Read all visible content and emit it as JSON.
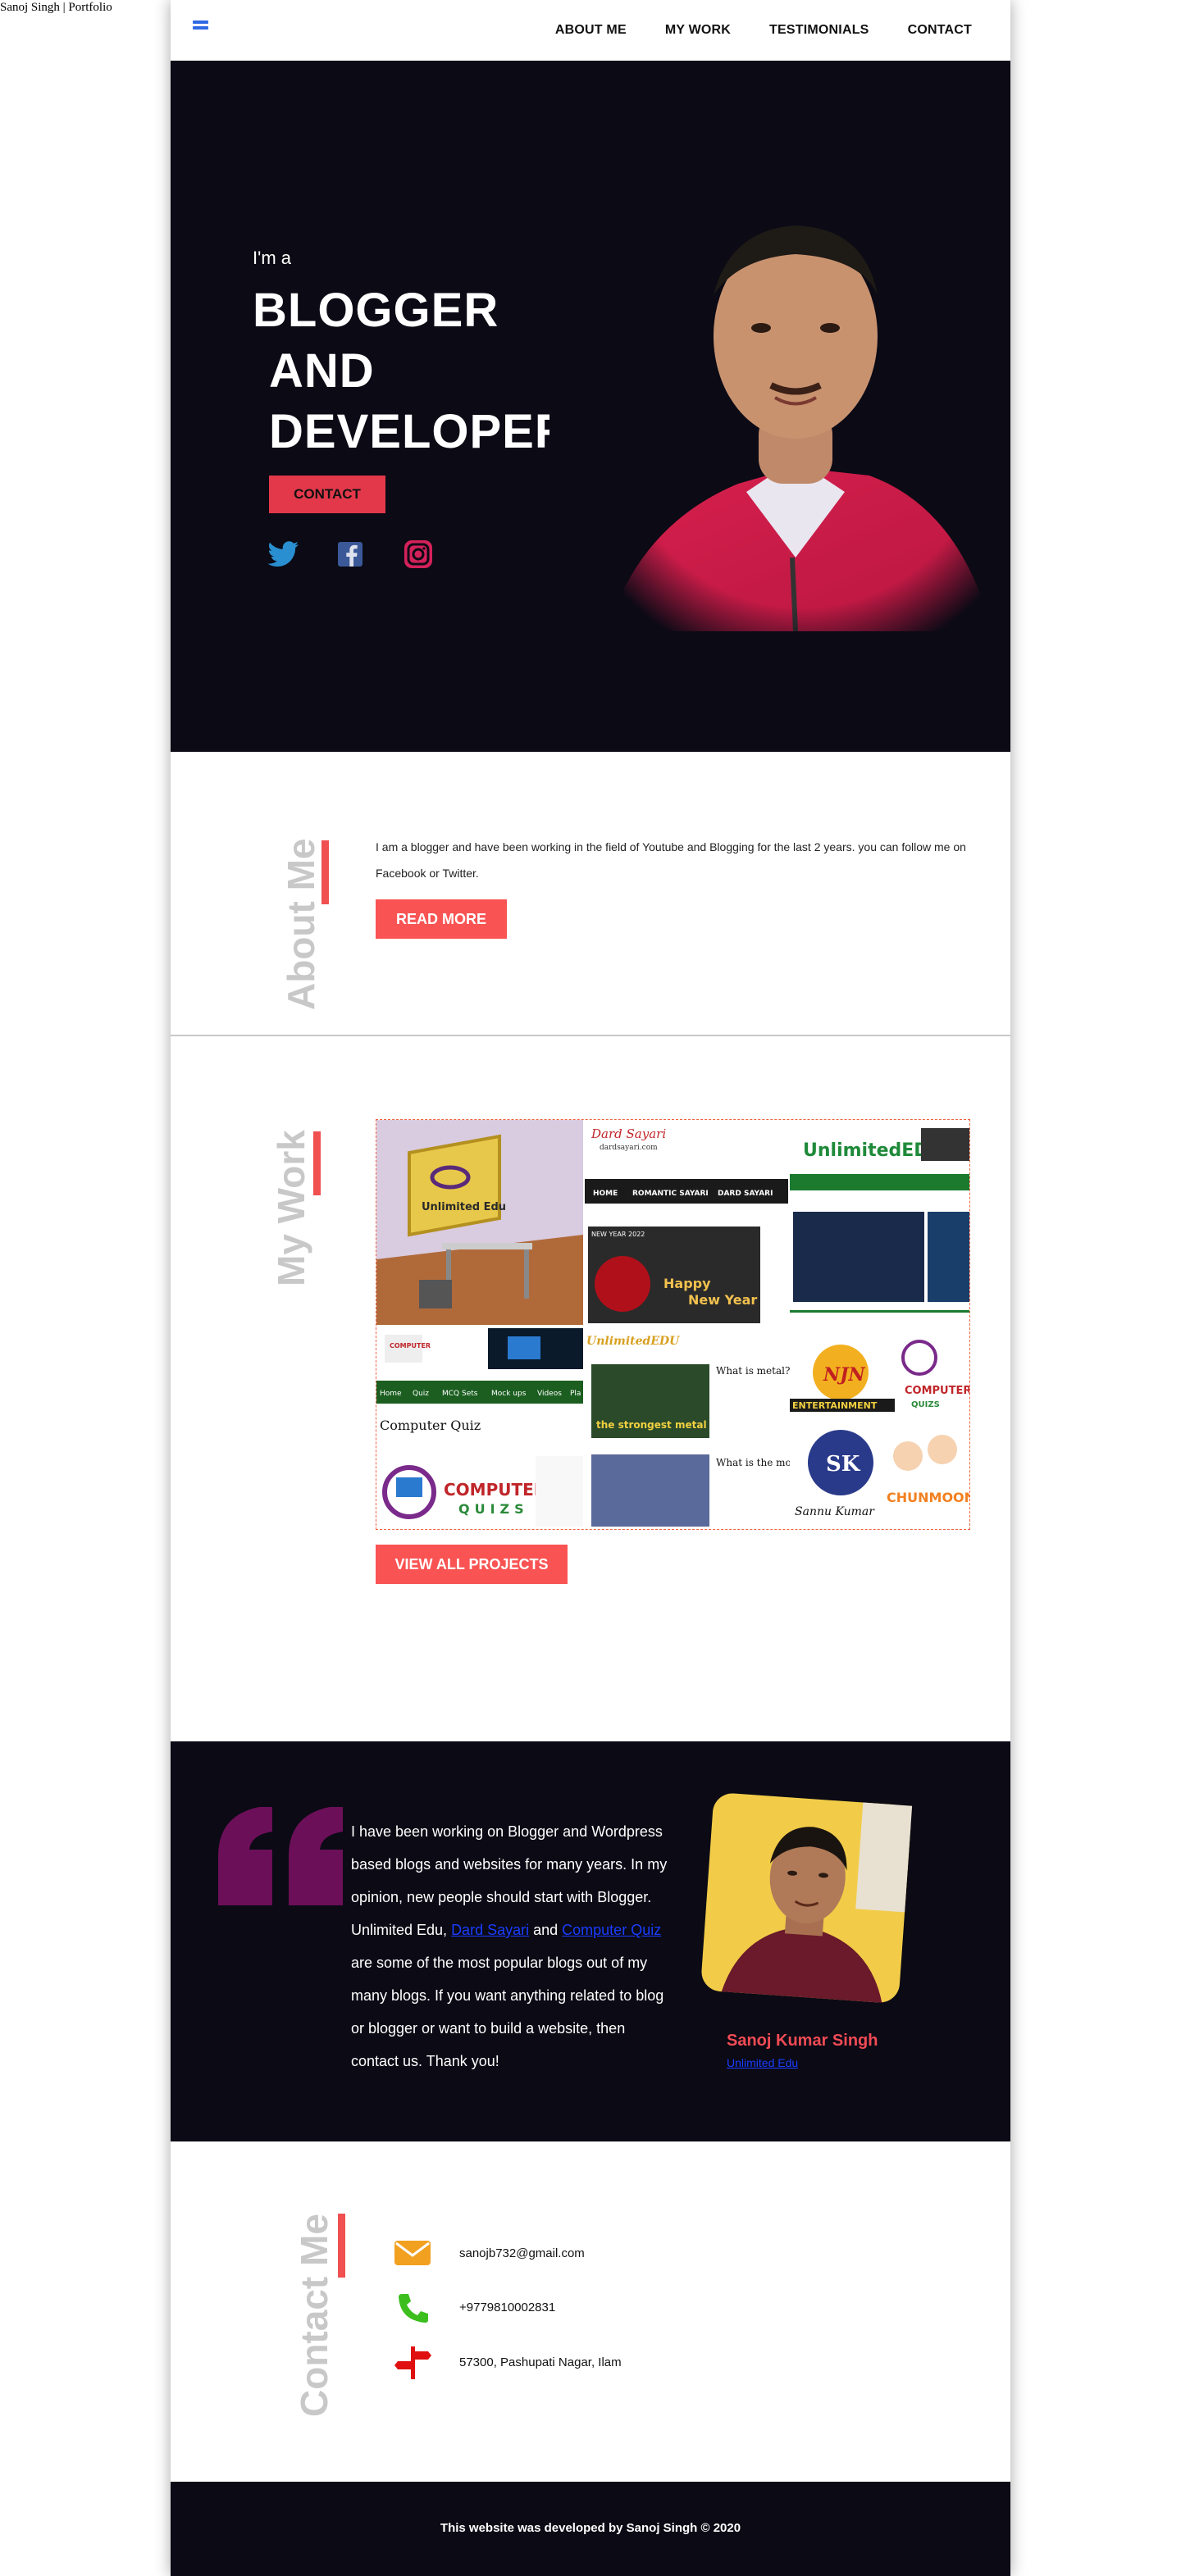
{
  "document_title": "Sanoj Singh | Portfolio",
  "nav": {
    "items": [
      "ABOUT ME",
      "MY WORK",
      "TESTIMONIALS",
      "CONTACT"
    ]
  },
  "hero": {
    "intro": "I'm a",
    "title_lines": [
      "BLOGGER",
      "AND",
      "DEVELOPER"
    ],
    "contact_button": "CONTACT",
    "social_icons": [
      "twitter-icon",
      "facebook-icon",
      "instagram-icon"
    ]
  },
  "about": {
    "heading": "About Me",
    "text": "I am a blogger and have been working in the field of Youtube and Blogging for the last 2 years. you can follow me on Facebook or Twitter.",
    "button": "READ MORE"
  },
  "work": {
    "heading": "My Work",
    "collage_texts": {
      "unlimited_edu": "Unlimited Edu",
      "dard_sayari": "Dard Sayari",
      "dard_domain": "dardsayari.com",
      "menu": [
        "HOME",
        "ROMANTIC SAYARI",
        "DARD SAYARI"
      ],
      "new_year_badge": "NEW YEAR 2022",
      "happy": "Happy",
      "new_year": "New Year",
      "unlimited_edu_logo": "UnlimitedEDU",
      "computer_quiz": "Computer Quiz",
      "computer": "COMPUTER",
      "quizs": "QUIZS",
      "what_is_metal": "What is metal? properties and",
      "strongest_metal": "the strongest metal",
      "what_is_most": "What is the mo and why? FAQ",
      "njn": "NJN",
      "entertainment": "ENTERTAINMENT",
      "sannu_kumar": "Sannu Kumar",
      "chunmoon": "CHUNMOON",
      "nav_small": [
        "Home",
        "Quiz",
        "MCQ Sets",
        "Mock ups",
        "Videos",
        "Pla"
      ]
    },
    "button": "VIEW ALL PROJECTS"
  },
  "testimonial": {
    "text_before": "I have been working on Blogger and Wordpress based blogs and websites for many years. In my opinion, new people should start with Blogger. Unlimited Edu, ",
    "link1": "Dard Sayari",
    "text_mid": " and ",
    "link2": "Computer Quiz",
    "text_after": " are some of the most popular blogs out of my many blogs. If you want anything related to blog or blogger or want to build a website, then contact us. Thank you!",
    "name": "Sanoj Kumar Singh",
    "site_link": "Unlimited Edu"
  },
  "contact": {
    "heading": "Contact Me",
    "email": "sanojb732@gmail.com",
    "phone": "+9779810002831",
    "address": "57300, Pashupati Nagar, Ilam"
  },
  "footer": {
    "text": "This website was developed by Sanoj Singh © 2020"
  },
  "colors": {
    "dark": "#0b0a15",
    "accent_red": "#f95353",
    "nav_blue": "#2f69e4",
    "quote_purple": "#6b0f58"
  }
}
